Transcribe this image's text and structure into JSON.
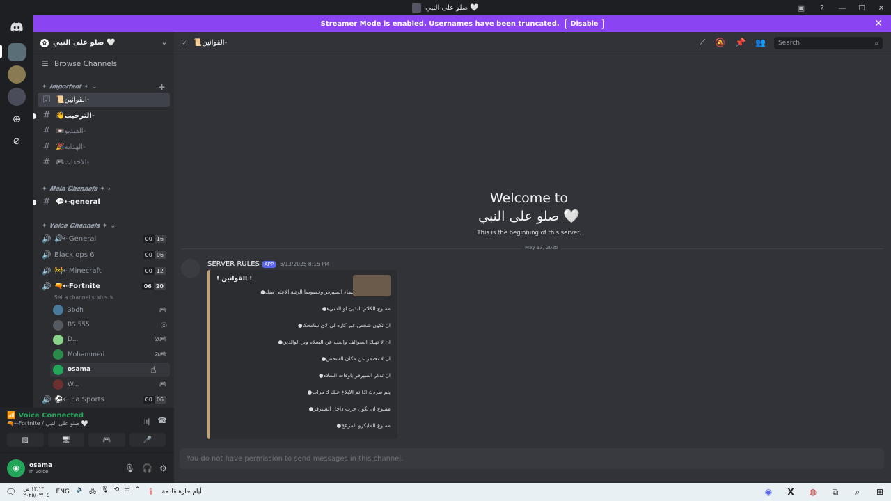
{
  "window": {
    "title": "صلو على النبي 🤍"
  },
  "banner": {
    "text": "Streamer Mode is enabled. Usernames have been truncated.",
    "disable_label": "Disable"
  },
  "guild": {
    "name": "صلو على النبي 🤍",
    "browse_label": "Browse Channels"
  },
  "categories": {
    "important": "✦ 𝑰𝒎𝒑𝒐𝒓𝒕𝒂𝒏𝒕 ✦",
    "main": "✦ 𝑴𝒂𝒊𝒏 𝑪𝒉𝒂𝒏𝒏𝒆𝒍𝒔 ✦",
    "voice": "✦ 𝑽𝒐𝒊𝒄𝒆 𝑪𝒉𝒂𝒏𝒏𝒆𝒍𝒔 ✦"
  },
  "text_channels": {
    "rules": "📜القوانين-",
    "welcome": "👋الترحيب-",
    "video": "📼الفيديو-",
    "gifts": "🎉الهدايه-",
    "events": "🎮الاحداث-",
    "general": "💬⇠general"
  },
  "voice_channels": {
    "general": {
      "name": "🔊⇠General",
      "count_a": "00",
      "count_b": "16"
    },
    "blackops": {
      "name": "Black ops 6",
      "count_a": "00",
      "count_b": "06"
    },
    "minecraft": {
      "name": "🚧⇠Minecraft",
      "count_a": "00",
      "count_b": "12"
    },
    "fortnite": {
      "name": "🔫⇠Fortnite",
      "count_a": "06",
      "count_b": "20",
      "status": "Set a channel status ✎"
    },
    "easports": {
      "name": "⚽⇠ Ea Sports",
      "count_a": "00",
      "count_b": "06"
    }
  },
  "members": [
    {
      "name": "3bdh",
      "color": "#4a7a9a",
      "status": "🎮"
    },
    {
      "name": "BS 555",
      "color": "#555a60",
      "status": "Ⓧ"
    },
    {
      "name": "D...",
      "color": "#8bd38b",
      "status": "🎮"
    },
    {
      "name": "Mohammed",
      "color": "#2a8a4a",
      "status": "🎮"
    },
    {
      "name": "osama",
      "color": "#23a55a",
      "status": ""
    },
    {
      "name": "W...",
      "color": "#6a3030",
      "status": "🎮"
    }
  ],
  "voice_panel": {
    "title": "Voice Connected",
    "subtitle": "🔫⇠Fortnite / صلو على النبي 🤍"
  },
  "user": {
    "name": "osama",
    "status": "In voice"
  },
  "main": {
    "channel_name": "📜القوانين-",
    "search_placeholder": "Search",
    "welcome_line1": "Welcome to",
    "welcome_line2": "صلو على النبي 🤍",
    "welcome_sub": "This is the beginning of this server.",
    "date_divider": "May 13, 2025",
    "composer_placeholder": "You do not have permission to send messages in this channel."
  },
  "message": {
    "author": "SERVER RULES",
    "tag": "APP",
    "time": "5/13/2025 8:15 PM",
    "embed_title": "! القوانين !",
    "rules": [
      "ان تحترم جميع اعضاء السيرفر وخصوصا الرتبة الاعلى منك",
      "ممنوع الكلام البذيئ او السيء",
      "ان تكون شخص غير كاره لي لاي سامحكا",
      "ان لا تهيك السوالف والعب عن السلاه وبر الوالدين",
      "ان لا تحتمر عن مكان الشخص",
      "ان تذكر السيرفر باوقات السلاه",
      "يتم طردك اذا تم الابلاغ عنك 3 مرات",
      "ممنوع ان تكون حزب داخل السيرفر",
      "ممنوع المايكرو المزعج"
    ]
  },
  "taskbar": {
    "time": "١٣:١٣ ص",
    "date": "٢٠٢٥/٠٣/٠٤",
    "lang": "ENG",
    "weather": "أيام حارة قادمة"
  },
  "colors": {
    "banner": "#8b44f2",
    "online": "#23a55a",
    "blurple": "#5865f2"
  }
}
